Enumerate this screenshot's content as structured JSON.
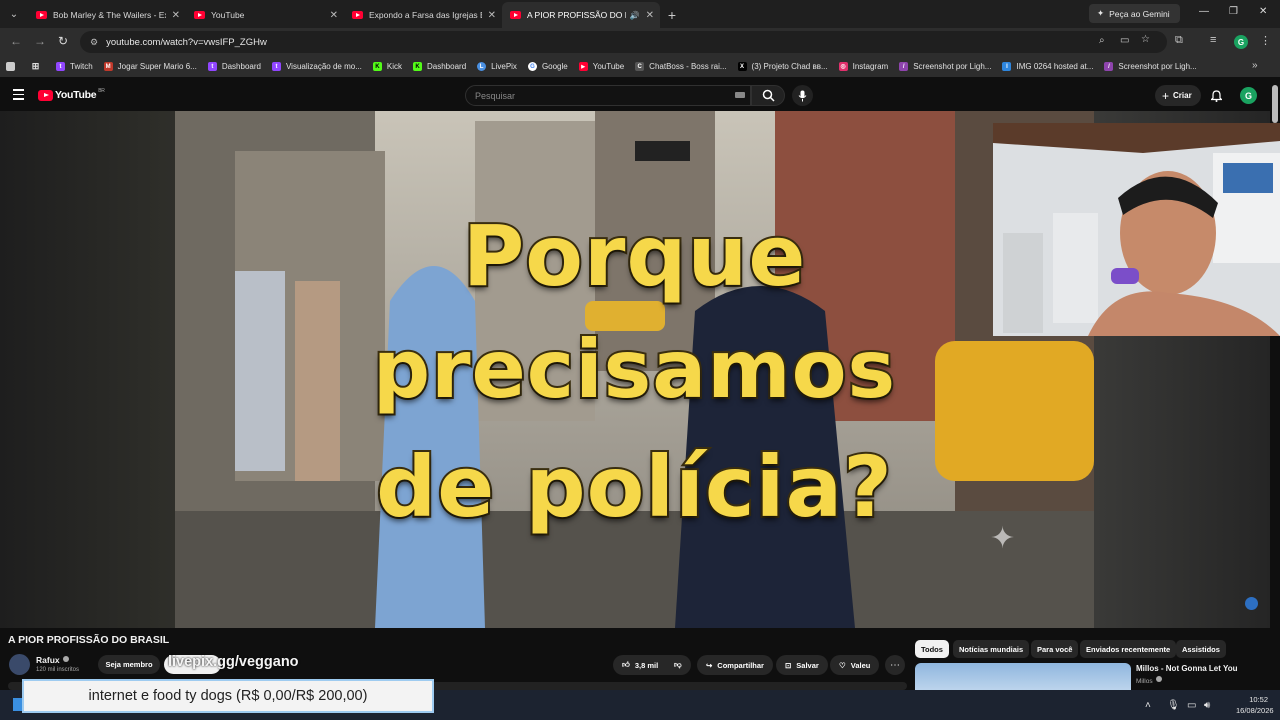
{
  "browser": {
    "tabs": [
      {
        "title": "Bob Marley & The Wailers - Exo",
        "active": false
      },
      {
        "title": "YouTube",
        "active": false
      },
      {
        "title": "Expondo a Farsa das Igrejas Eva",
        "active": false
      },
      {
        "title": "A PIOR PROFISSÃO DO BRA",
        "active": true
      }
    ],
    "gemini_label": "Peça ao Gemini",
    "url": "youtube.com/watch?v=vwsIFP_ZGHw",
    "profile_initial": "G",
    "bookmarks": [
      {
        "label": "Twitch",
        "color": "#9146ff",
        "glyph": "t"
      },
      {
        "label": "Jogar Super Mario 6...",
        "color": "#c0392b",
        "glyph": "M"
      },
      {
        "label": "Dashboard",
        "color": "#9146ff",
        "glyph": "t"
      },
      {
        "label": "Visualização de mo...",
        "color": "#9146ff",
        "glyph": "t"
      },
      {
        "label": "Kick",
        "color": "#53fc18",
        "glyph": "K"
      },
      {
        "label": "Dashboard",
        "color": "#53fc18",
        "glyph": "K"
      },
      {
        "label": "LivePix",
        "color": "#4a90e2",
        "glyph": "L"
      },
      {
        "label": "Google",
        "color": "#ffffff",
        "glyph": "G"
      },
      {
        "label": "YouTube",
        "color": "#ff0033",
        "glyph": "▶"
      },
      {
        "label": "ChatBoss - Boss rai...",
        "color": "#555555",
        "glyph": "C"
      },
      {
        "label": "(3) Projeto Chad вв...",
        "color": "#000000",
        "glyph": "X"
      },
      {
        "label": "Instagram",
        "color": "#e1306c",
        "glyph": "◎"
      },
      {
        "label": "Screenshot por Ligh...",
        "color": "#8e44ad",
        "glyph": "/"
      },
      {
        "label": "IMG 0264 hosted at...",
        "color": "#2e86de",
        "glyph": "I"
      },
      {
        "label": "Screenshot por Ligh...",
        "color": "#8e44ad",
        "glyph": "/"
      }
    ]
  },
  "youtube": {
    "logo_text": "YouTube",
    "country_code": "BR",
    "search_placeholder": "Pesquisar",
    "create_label": "Criar",
    "avatar_initial": "G"
  },
  "video": {
    "thumbnail_lines": [
      "Porque",
      "precisamos",
      "de polícia?"
    ],
    "title": "A PIOR PROFISSÃO DO BRASIL",
    "channel_name": "Rafux",
    "channel_subs": "120 mil inscritos",
    "member_label": "Seja membro",
    "overlay_handle": "livepix.gg/veggano",
    "likes": "3,8 mil",
    "share_label": "Compartilhar",
    "save_label": "Salvar",
    "thanks_label": "Valeu"
  },
  "sidebar": {
    "chips": [
      "Todos",
      "Notícias mundiais",
      "Para você",
      "Enviados recentemente",
      "Assistidos"
    ],
    "rec_title": "Millos - Not Gonna Let You",
    "rec_channel": "Millos"
  },
  "donation_goal": "internet e food ty dogs (R$ 0,00/R$ 200,00)",
  "taskbar": {
    "time": "10:52",
    "date": "16/08/2026"
  },
  "colors": {
    "youtube_red": "#ff0033",
    "thumbnail_text": "#f6d84a",
    "background": "#0f0f0f"
  }
}
